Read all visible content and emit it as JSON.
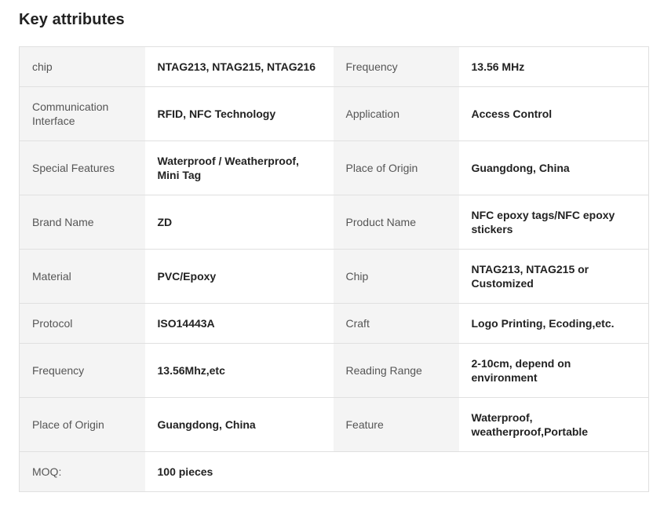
{
  "section": {
    "title": "Key attributes"
  },
  "rows": [
    {
      "l1": "chip",
      "v1": "NTAG213, NTAG215, NTAG216",
      "l2": "Frequency",
      "v2": "13.56 MHz"
    },
    {
      "l1": "Communication Interface",
      "v1": "RFID, NFC Technology",
      "l2": "Application",
      "v2": "Access Control"
    },
    {
      "l1": "Special Features",
      "v1": "Waterproof / Weatherproof, Mini Tag",
      "l2": "Place of Origin",
      "v2": "Guangdong, China"
    },
    {
      "l1": "Brand Name",
      "v1": "ZD",
      "l2": "Product Name",
      "v2": "NFC epoxy tags/NFC epoxy stickers"
    },
    {
      "l1": "Material",
      "v1": "PVC/Epoxy",
      "l2": "Chip",
      "v2": "NTAG213, NTAG215 or Customized"
    },
    {
      "l1": "Protocol",
      "v1": "ISO14443A",
      "l2": "Craft",
      "v2": "Logo Printing, Ecoding,etc."
    },
    {
      "l1": "Frequency",
      "v1": "13.56Mhz,etc",
      "l2": "Reading Range",
      "v2": "2-10cm, depend on environment"
    },
    {
      "l1": "Place of Origin",
      "v1": "Guangdong, China",
      "l2": "Feature",
      "v2": "Waterproof, weatherproof,Portable"
    },
    {
      "l1": "MOQ:",
      "v1": "100 pieces"
    }
  ]
}
